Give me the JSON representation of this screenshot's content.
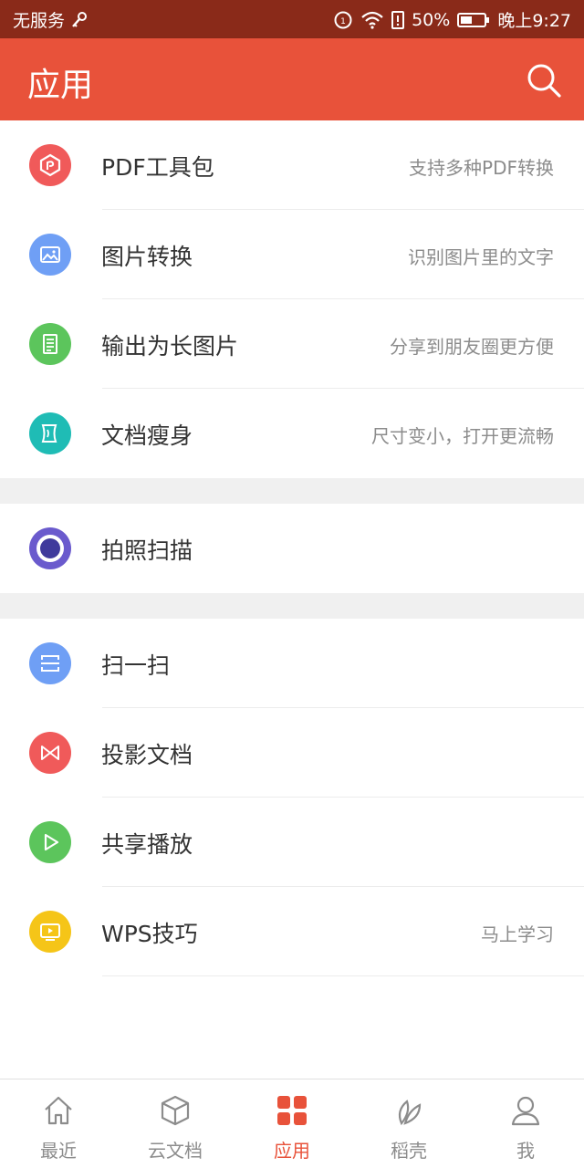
{
  "status_bar": {
    "carrier": "无服务",
    "battery": "50%",
    "time": "晚上9:27"
  },
  "header": {
    "title": "应用",
    "search_icon": "search-icon"
  },
  "sections": [
    {
      "items": [
        {
          "label": "PDF工具包",
          "desc": "支持多种PDF转换",
          "icon": "pdf-tool-icon",
          "color": "#f05a5a"
        },
        {
          "label": "图片转换",
          "desc": "识别图片里的文字",
          "icon": "image-icon",
          "color": "#6f9ff5"
        },
        {
          "label": "输出为长图片",
          "desc": "分享到朋友圈更方便",
          "icon": "long-image-icon",
          "color": "#5cc55c"
        },
        {
          "label": "文档瘦身",
          "desc": "尺寸变小，打开更流畅",
          "icon": "slim-doc-icon",
          "color": "#1fbcb5"
        }
      ]
    },
    {
      "items": [
        {
          "label": "拍照扫描",
          "icon": "camera-scan-icon",
          "color": "#6a5acd"
        }
      ]
    },
    {
      "items": [
        {
          "label": "扫一扫",
          "icon": "scan-icon",
          "color": "#6f9ff5"
        },
        {
          "label": "投影文档",
          "icon": "projection-icon",
          "color": "#f05a5a"
        },
        {
          "label": "共享播放",
          "icon": "play-icon",
          "color": "#5cc55c"
        },
        {
          "label": "WPS技巧",
          "desc": "马上学习",
          "icon": "tips-video-icon",
          "color": "#f5c518"
        }
      ]
    }
  ],
  "tabs": [
    {
      "label": "最近",
      "icon": "home-icon",
      "active": false
    },
    {
      "label": "云文档",
      "icon": "cloud-box-icon",
      "active": false
    },
    {
      "label": "应用",
      "icon": "apps-grid-icon",
      "active": true
    },
    {
      "label": "稻壳",
      "icon": "leaf-icon",
      "active": false
    },
    {
      "label": "我",
      "icon": "user-icon",
      "active": false
    }
  ],
  "colors": {
    "accent": "#e8523a",
    "status_bar": "#8a2a19",
    "separator": "#f0f0f0",
    "text": "#333333",
    "muted": "#8c8c8c"
  }
}
